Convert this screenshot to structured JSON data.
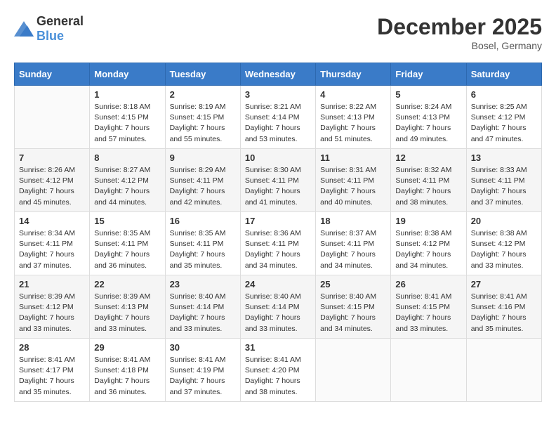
{
  "header": {
    "logo_general": "General",
    "logo_blue": "Blue",
    "title": "December 2025",
    "location": "Bosel, Germany"
  },
  "calendar": {
    "days_of_week": [
      "Sunday",
      "Monday",
      "Tuesday",
      "Wednesday",
      "Thursday",
      "Friday",
      "Saturday"
    ],
    "weeks": [
      [
        {
          "day": "",
          "sunrise": "",
          "sunset": "",
          "daylight": ""
        },
        {
          "day": "1",
          "sunrise": "Sunrise: 8:18 AM",
          "sunset": "Sunset: 4:15 PM",
          "daylight": "Daylight: 7 hours and 57 minutes."
        },
        {
          "day": "2",
          "sunrise": "Sunrise: 8:19 AM",
          "sunset": "Sunset: 4:15 PM",
          "daylight": "Daylight: 7 hours and 55 minutes."
        },
        {
          "day": "3",
          "sunrise": "Sunrise: 8:21 AM",
          "sunset": "Sunset: 4:14 PM",
          "daylight": "Daylight: 7 hours and 53 minutes."
        },
        {
          "day": "4",
          "sunrise": "Sunrise: 8:22 AM",
          "sunset": "Sunset: 4:13 PM",
          "daylight": "Daylight: 7 hours and 51 minutes."
        },
        {
          "day": "5",
          "sunrise": "Sunrise: 8:24 AM",
          "sunset": "Sunset: 4:13 PM",
          "daylight": "Daylight: 7 hours and 49 minutes."
        },
        {
          "day": "6",
          "sunrise": "Sunrise: 8:25 AM",
          "sunset": "Sunset: 4:12 PM",
          "daylight": "Daylight: 7 hours and 47 minutes."
        }
      ],
      [
        {
          "day": "7",
          "sunrise": "Sunrise: 8:26 AM",
          "sunset": "Sunset: 4:12 PM",
          "daylight": "Daylight: 7 hours and 45 minutes."
        },
        {
          "day": "8",
          "sunrise": "Sunrise: 8:27 AM",
          "sunset": "Sunset: 4:12 PM",
          "daylight": "Daylight: 7 hours and 44 minutes."
        },
        {
          "day": "9",
          "sunrise": "Sunrise: 8:29 AM",
          "sunset": "Sunset: 4:11 PM",
          "daylight": "Daylight: 7 hours and 42 minutes."
        },
        {
          "day": "10",
          "sunrise": "Sunrise: 8:30 AM",
          "sunset": "Sunset: 4:11 PM",
          "daylight": "Daylight: 7 hours and 41 minutes."
        },
        {
          "day": "11",
          "sunrise": "Sunrise: 8:31 AM",
          "sunset": "Sunset: 4:11 PM",
          "daylight": "Daylight: 7 hours and 40 minutes."
        },
        {
          "day": "12",
          "sunrise": "Sunrise: 8:32 AM",
          "sunset": "Sunset: 4:11 PM",
          "daylight": "Daylight: 7 hours and 38 minutes."
        },
        {
          "day": "13",
          "sunrise": "Sunrise: 8:33 AM",
          "sunset": "Sunset: 4:11 PM",
          "daylight": "Daylight: 7 hours and 37 minutes."
        }
      ],
      [
        {
          "day": "14",
          "sunrise": "Sunrise: 8:34 AM",
          "sunset": "Sunset: 4:11 PM",
          "daylight": "Daylight: 7 hours and 37 minutes."
        },
        {
          "day": "15",
          "sunrise": "Sunrise: 8:35 AM",
          "sunset": "Sunset: 4:11 PM",
          "daylight": "Daylight: 7 hours and 36 minutes."
        },
        {
          "day": "16",
          "sunrise": "Sunrise: 8:35 AM",
          "sunset": "Sunset: 4:11 PM",
          "daylight": "Daylight: 7 hours and 35 minutes."
        },
        {
          "day": "17",
          "sunrise": "Sunrise: 8:36 AM",
          "sunset": "Sunset: 4:11 PM",
          "daylight": "Daylight: 7 hours and 34 minutes."
        },
        {
          "day": "18",
          "sunrise": "Sunrise: 8:37 AM",
          "sunset": "Sunset: 4:11 PM",
          "daylight": "Daylight: 7 hours and 34 minutes."
        },
        {
          "day": "19",
          "sunrise": "Sunrise: 8:38 AM",
          "sunset": "Sunset: 4:12 PM",
          "daylight": "Daylight: 7 hours and 34 minutes."
        },
        {
          "day": "20",
          "sunrise": "Sunrise: 8:38 AM",
          "sunset": "Sunset: 4:12 PM",
          "daylight": "Daylight: 7 hours and 33 minutes."
        }
      ],
      [
        {
          "day": "21",
          "sunrise": "Sunrise: 8:39 AM",
          "sunset": "Sunset: 4:12 PM",
          "daylight": "Daylight: 7 hours and 33 minutes."
        },
        {
          "day": "22",
          "sunrise": "Sunrise: 8:39 AM",
          "sunset": "Sunset: 4:13 PM",
          "daylight": "Daylight: 7 hours and 33 minutes."
        },
        {
          "day": "23",
          "sunrise": "Sunrise: 8:40 AM",
          "sunset": "Sunset: 4:14 PM",
          "daylight": "Daylight: 7 hours and 33 minutes."
        },
        {
          "day": "24",
          "sunrise": "Sunrise: 8:40 AM",
          "sunset": "Sunset: 4:14 PM",
          "daylight": "Daylight: 7 hours and 33 minutes."
        },
        {
          "day": "25",
          "sunrise": "Sunrise: 8:40 AM",
          "sunset": "Sunset: 4:15 PM",
          "daylight": "Daylight: 7 hours and 34 minutes."
        },
        {
          "day": "26",
          "sunrise": "Sunrise: 8:41 AM",
          "sunset": "Sunset: 4:15 PM",
          "daylight": "Daylight: 7 hours and 33 minutes."
        },
        {
          "day": "27",
          "sunrise": "Sunrise: 8:41 AM",
          "sunset": "Sunset: 4:16 PM",
          "daylight": "Daylight: 7 hours and 35 minutes."
        }
      ],
      [
        {
          "day": "28",
          "sunrise": "Sunrise: 8:41 AM",
          "sunset": "Sunset: 4:17 PM",
          "daylight": "Daylight: 7 hours and 35 minutes."
        },
        {
          "day": "29",
          "sunrise": "Sunrise: 8:41 AM",
          "sunset": "Sunset: 4:18 PM",
          "daylight": "Daylight: 7 hours and 36 minutes."
        },
        {
          "day": "30",
          "sunrise": "Sunrise: 8:41 AM",
          "sunset": "Sunset: 4:19 PM",
          "daylight": "Daylight: 7 hours and 37 minutes."
        },
        {
          "day": "31",
          "sunrise": "Sunrise: 8:41 AM",
          "sunset": "Sunset: 4:20 PM",
          "daylight": "Daylight: 7 hours and 38 minutes."
        },
        {
          "day": "",
          "sunrise": "",
          "sunset": "",
          "daylight": ""
        },
        {
          "day": "",
          "sunrise": "",
          "sunset": "",
          "daylight": ""
        },
        {
          "day": "",
          "sunrise": "",
          "sunset": "",
          "daylight": ""
        }
      ]
    ]
  }
}
